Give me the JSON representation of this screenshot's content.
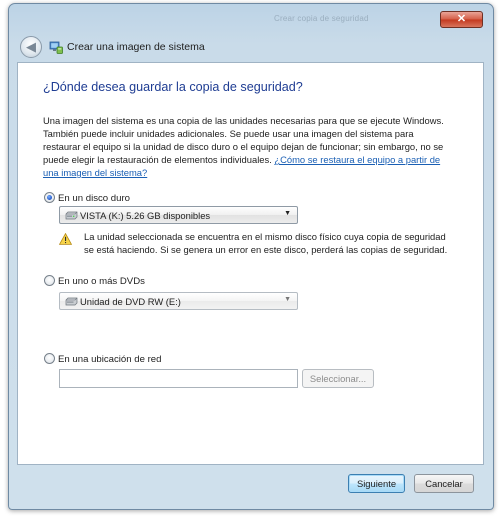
{
  "window": {
    "faded_title": "Crear copia de seguridad",
    "close_glyph": "✕"
  },
  "nav": {
    "back_glyph": "◀",
    "title": "Crear una imagen de sistema"
  },
  "content": {
    "heading": "¿Dónde desea guardar la copia de seguridad?",
    "description": "Una imagen del sistema es una copia de las unidades necesarias para que se ejecute Windows. También puede incluir unidades adicionales. Se puede usar una imagen del sistema para restaurar el equipo si la unidad de disco duro o el equipo dejan de funcionar; sin embargo, no se puede elegir la restauración de elementos individuales.",
    "help_link": "¿Cómo se restaura el equipo a partir de una imagen del sistema?"
  },
  "options": {
    "hard_disk": {
      "label": "En un disco duro",
      "selected": true,
      "dropdown_value": "VISTA (K:)  5.26 GB disponibles",
      "icon": "hard-drive-icon"
    },
    "warning": {
      "icon": "warning-icon",
      "text": "La unidad seleccionada se encuentra en el mismo disco físico cuya copia de seguridad se está haciendo. Si se genera un error en este disco, perderá las copias de seguridad."
    },
    "dvd": {
      "label": "En uno o más DVDs",
      "selected": false,
      "dropdown_value": "Unidad de DVD RW (E:)",
      "icon": "dvd-drive-icon"
    },
    "network": {
      "label": "En una ubicación de red",
      "selected": false,
      "input_value": "",
      "select_button": "Seleccionar..."
    }
  },
  "footer": {
    "next_button": "Siguiente",
    "cancel_button": "Cancelar"
  },
  "colors": {
    "heading": "#1f3d93",
    "link": "#1a5fb4",
    "close_button": "#c3391f",
    "frame": "#cfe0ec"
  }
}
